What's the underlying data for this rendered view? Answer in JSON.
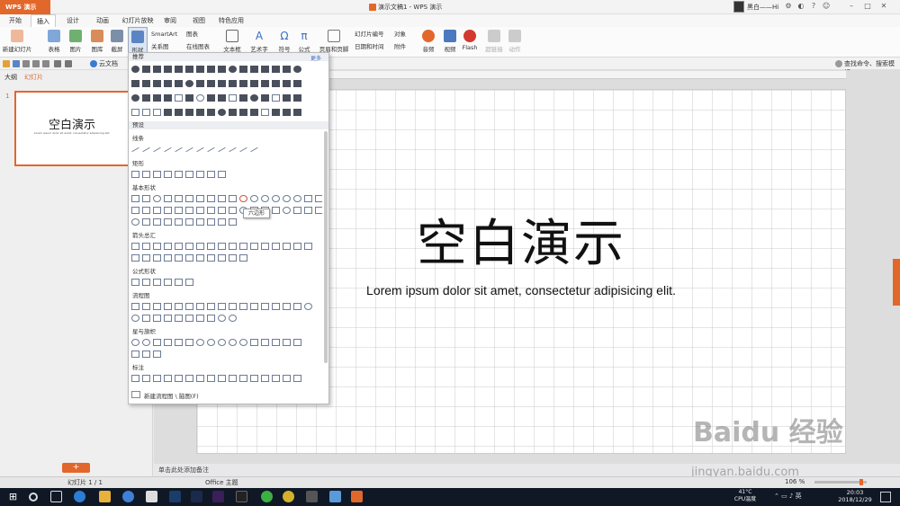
{
  "titlebar": {
    "app_label": "WPS 演示",
    "doc_title": "演示文稿1 - WPS 演示",
    "user": "黑白——Hi"
  },
  "menu": {
    "tabs": [
      "开始",
      "插入",
      "设计",
      "动画",
      "幻灯片放映",
      "审阅",
      "视图",
      "特色应用"
    ],
    "active": "插入"
  },
  "ribbon": {
    "new_slide": "新建幻灯片",
    "table": "表格",
    "picture": "图片",
    "gallery": "图库",
    "screenshot": "截屏",
    "shape": "形状",
    "smartart": "SmartArt",
    "chart": "图表",
    "relation": "关系图",
    "online_chart": "在线图表",
    "textbox": "文本框",
    "wordart": "艺术字",
    "symbol": "符号",
    "formula": "公式",
    "header_footer": "页眉和页脚",
    "slide_number": "幻灯片编号",
    "object": "对象",
    "datetime": "日期和时间",
    "attachment": "附件",
    "audio": "音频",
    "video": "视频",
    "flash": "Flash",
    "hyperlink": "超链接",
    "action": "动作"
  },
  "quickbar": {
    "cloud": "云文档",
    "search": "查找命令、搜索模板"
  },
  "left_panel": {
    "tab_outline": "大纲",
    "tab_slides": "幻灯片",
    "thumb_number": "1",
    "thumb_title": "空白演示",
    "thumb_sub": "Lorem ipsum dolor sit amet, consectetur adipisicing elit."
  },
  "slide": {
    "title": "空白演示",
    "subtitle": "Lorem ipsum dolor sit amet, consectetur adipisicing elit."
  },
  "notes": {
    "placeholder": "单击此处添加备注"
  },
  "status": {
    "slide_pos": "幻灯片 1 / 1",
    "theme": "Office 主题",
    "zoom": "106 %"
  },
  "shape_panel": {
    "recommend": "推荐",
    "more": "更多",
    "preset": "预设",
    "sections": [
      "线条",
      "矩形",
      "基本形状",
      "箭头总汇",
      "公式形状",
      "流程图",
      "星与旗帜",
      "标注"
    ],
    "tooltip": "六边形",
    "new_flow": "新建流程图 \\ 脑图(F)"
  },
  "taskbar": {
    "temp": "41°C",
    "cpu": "CPU温度",
    "time": "20:03",
    "date": "2018/12/29"
  },
  "watermark": {
    "brand": "Baidu 经验",
    "url": "jingyan.baidu.com"
  },
  "colors": {
    "accent": "#e2672a",
    "taskbar": "#101826"
  }
}
